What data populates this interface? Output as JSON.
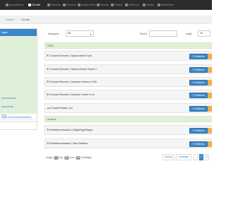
{
  "nav": {
    "items": [
      {
        "label": "Anschlüsse",
        "active": false
      },
      {
        "label": "Geräte",
        "active": true
      },
      {
        "label": "Dimmer",
        "active": false
      },
      {
        "label": "Scenes",
        "active": false
      },
      {
        "label": "Sequenzen",
        "active": false
      },
      {
        "label": "Shows",
        "active": false
      },
      {
        "label": "Status",
        "active": false
      },
      {
        "label": "Aktionen",
        "active": false
      },
      {
        "label": "Seiten",
        "active": false
      },
      {
        "label": "Abmelden",
        "active": false
      }
    ]
  },
  "breadcrumb": {
    "home": "Home",
    "separator": "/",
    "current": "Geräte"
  },
  "sidebar": {
    "items": [
      {
        "label": "lägen",
        "active": true
      },
      {
        "label": "ogekommandos(Handler)",
        "active": false
      },
      {
        "label": "kommandos",
        "active": false
      },
      {
        "label": "ommande",
        "active": false
      },
      {
        "label": "ping",
        "active": false
      }
    ]
  },
  "filters": {
    "category_label": "Kategorie",
    "category_value": "All",
    "search_label": "Suche",
    "search_value": "",
    "show_label": "zeige",
    "show_value": "10"
  },
  "groups": [
    {
      "name": "DMX",
      "rows": [
        {
          "icon": "Ⅲ",
          "label": "1 Kanal Dimmer | Sauna Bank Spot"
        },
        {
          "icon": "Ⅲ",
          "label": "1 Kanal Dimmer | Sauna Decke Spots 1"
        },
        {
          "icon": "Ⅲ",
          "label": "8 Kanal Dimmer | Scanner hinten Li+Re"
        },
        {
          "icon": "Ⅲ",
          "label": "8 Kanal Dimmer | Scanner Vorne li+re"
        },
        {
          "icon": "☁",
          "label": "1 Kanal Relais | UV"
        }
      ]
    },
    {
      "name": "Andere",
      "rows": [
        {
          "icon": "⚙",
          "label": "Gerätekommando | BrightSignPlayer"
        },
        {
          "icon": "⚙",
          "label": "Gerätekommando | Nec Beamer"
        }
      ]
    }
  ],
  "edit_label": "Editieren",
  "pager": {
    "prefix": "zeige",
    "from": "1",
    "mid": "bis",
    "to": "10",
    "of": "von",
    "total": "37",
    "suffix": "Einträge"
  },
  "pagination": {
    "first": "Anfang",
    "prev": "vorherige",
    "numbers": [
      "1",
      "2"
    ],
    "active": "1",
    "next": "›"
  },
  "colors": {
    "primary": "#3a87c8",
    "group_bg": "#dff0d8",
    "nav_bg": "#2c2c2c",
    "warning": "#f0ad4e"
  }
}
